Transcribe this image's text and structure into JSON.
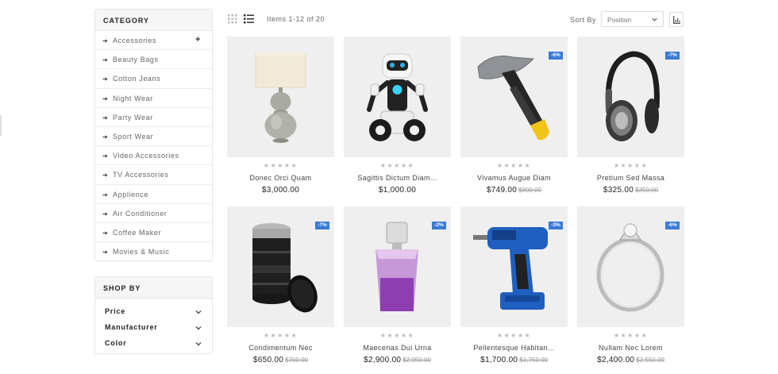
{
  "sidebar": {
    "category_title": "CATEGORY",
    "categories": [
      {
        "label": "Accessories",
        "expand": "+"
      },
      {
        "label": "Beauty Bags"
      },
      {
        "label": "Cotton Jeans"
      },
      {
        "label": "Night Wear"
      },
      {
        "label": "Party Wear"
      },
      {
        "label": "Sport Wear"
      },
      {
        "label": "Video Accessories"
      },
      {
        "label": "TV Accessories"
      },
      {
        "label": "Applience"
      },
      {
        "label": "Air Conditioner"
      },
      {
        "label": "Coffee Maker"
      },
      {
        "label": "Movies & Music"
      }
    ],
    "shop_by_title": "SHOP BY",
    "filters": [
      {
        "label": "Price"
      },
      {
        "label": "Manufacturer"
      },
      {
        "label": "Color"
      }
    ]
  },
  "toolbar": {
    "items_count": "Items 1-12 of 20",
    "sort_label": "Sort By",
    "sort_value": "Position"
  },
  "products": [
    {
      "name": "Donec Orci Quam",
      "price": "$3,000.00",
      "old_price": "",
      "badge": "",
      "stars": "★★★★★",
      "rating": 0,
      "image": "lamp"
    },
    {
      "name": "Sagittis Dictum Diam...",
      "price": "$1,000.00",
      "old_price": "",
      "badge": "",
      "stars": "★★★★★",
      "rating": 0,
      "image": "robot"
    },
    {
      "name": "Vivamus Augue Diam",
      "price": "$749.00",
      "old_price": "$800.00",
      "badge": "-6%",
      "stars": "★★★★★",
      "rating": 0,
      "image": "hammer"
    },
    {
      "name": "Pretium Sed Massa",
      "price": "$325.00",
      "old_price": "$350.00",
      "badge": "-7%",
      "stars": "★★★★★",
      "rating": 0,
      "image": "headphones"
    },
    {
      "name": "Condimentum Nec",
      "price": "$650.00",
      "old_price": "$700.00",
      "badge": "-7%",
      "stars": "★★★★★",
      "rating": 0,
      "image": "lens-mug"
    },
    {
      "name": "Maecenas Dui Urna",
      "price": "$2,900.00",
      "old_price": "$2,950.00",
      "badge": "-2%",
      "stars": "★★★★★",
      "rating": 0,
      "image": "perfume"
    },
    {
      "name": "Pellentesque Habitan...",
      "price": "$1,700.00",
      "old_price": "$1,750.00",
      "badge": "-3%",
      "stars": "★★★★★",
      "rating": 0,
      "image": "drill"
    },
    {
      "name": "Nullam Nec Lorem",
      "price": "$2,400.00",
      "old_price": "$2,550.00",
      "badge": "-6%",
      "stars": "★★★★★",
      "rating": 0,
      "image": "ring"
    }
  ]
}
